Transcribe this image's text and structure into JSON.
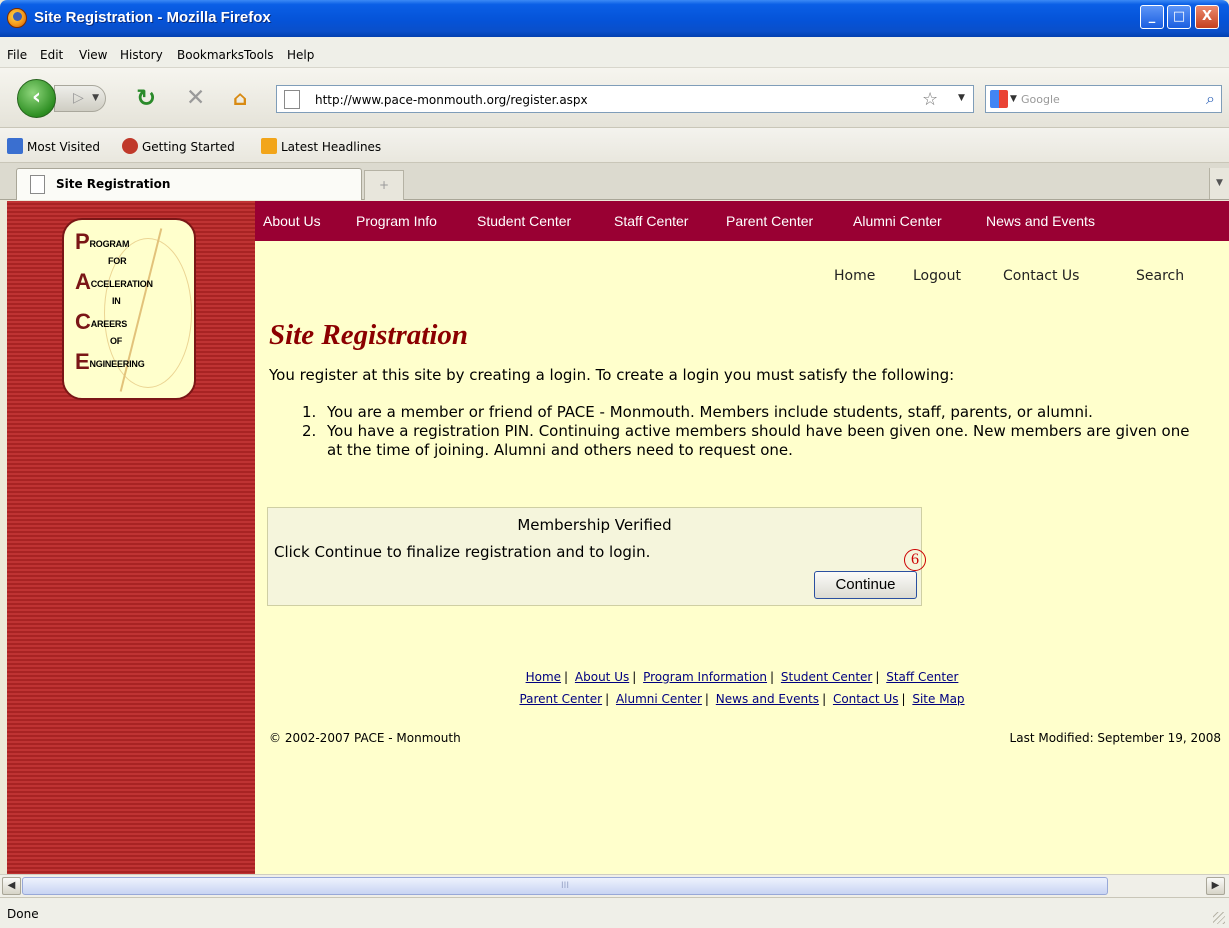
{
  "window": {
    "title": "Site Registration - Mozilla Firefox",
    "controls": {
      "minimize": "_",
      "maximize": "□",
      "close": "X"
    }
  },
  "menu": [
    "File",
    "Edit",
    "View",
    "History",
    "Bookmarks",
    "Tools",
    "Help"
  ],
  "toolbar": {
    "url": "http://www.pace-monmouth.org/register.aspx",
    "search_placeholder": "Google",
    "icons": [
      "back-icon",
      "forward-icon",
      "reload-icon",
      "stop-icon",
      "home-icon",
      "bookmark-star-icon",
      "search-icon"
    ]
  },
  "bookmarks": [
    "Most Visited",
    "Getting Started",
    "Latest Headlines"
  ],
  "tabs": [
    {
      "label": "Site Registration"
    }
  ],
  "site": {
    "logo_lines": [
      {
        "big": "P",
        "rest": "ROGRAM"
      },
      {
        "big": "",
        "rest": "FOR"
      },
      {
        "big": "A",
        "rest": "CCELERATION"
      },
      {
        "big": "",
        "rest": "IN"
      },
      {
        "big": "C",
        "rest": "AREERS"
      },
      {
        "big": "",
        "rest": "OF"
      },
      {
        "big": "E",
        "rest": "NGINEERING"
      }
    ],
    "top_nav": [
      "About Us",
      "Program Info",
      "Student Center",
      "Staff Center",
      "Parent Center",
      "Alumni Center",
      "News and Events"
    ],
    "util_nav": [
      "Home",
      "Logout",
      "Contact Us",
      "Search"
    ],
    "heading": "Site Registration",
    "intro": "You register at this site by creating a login. To create a login you must satisfy the following:",
    "requirements": [
      {
        "num": "1.",
        "text": "You are a member or friend of PACE - Monmouth. Members include students, staff, parents, or alumni."
      },
      {
        "num": "2.",
        "text": "You have a registration PIN. Continuing active members should have been given one. New members are given one at the time of joining. Alumni and others need to request one."
      }
    ],
    "verify_box": {
      "title": "Membership Verified",
      "message": "Click Continue to finalize registration and to login.",
      "button": "Continue",
      "marker": "6"
    },
    "footer_links_row1": [
      "Home",
      "About Us",
      "Program Information",
      "Student Center",
      "Staff Center"
    ],
    "footer_links_row2": [
      "Parent Center",
      "Alumni Center",
      "News and Events",
      "Contact Us",
      "Site Map"
    ],
    "copyright": "© 2002-2007 PACE - Monmouth",
    "last_modified": "Last Modified: September 19, 2008"
  },
  "status": {
    "text": "Done",
    "scroll_grip": "III"
  },
  "colors": {
    "brand_maroon": "#990033",
    "page_bg": "#ffffcc",
    "sidebar_red": "#b02828",
    "heading": "#8b0000"
  }
}
